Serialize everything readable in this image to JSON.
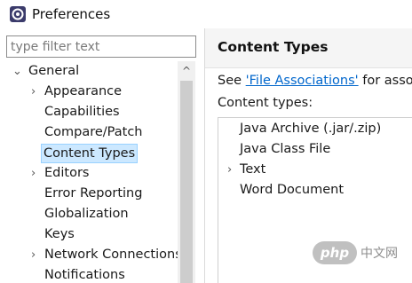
{
  "window": {
    "title": "Preferences"
  },
  "filter": {
    "placeholder": "type filter text"
  },
  "tree": [
    {
      "label": "General",
      "twisty": "⌄"
    },
    {
      "label": "Appearance",
      "twisty": "›"
    },
    {
      "label": "Capabilities",
      "twisty": ""
    },
    {
      "label": "Compare/Patch",
      "twisty": ""
    },
    {
      "label": "Content Types",
      "twisty": "",
      "selected": true
    },
    {
      "label": "Editors",
      "twisty": "›"
    },
    {
      "label": "Error Reporting",
      "twisty": ""
    },
    {
      "label": "Globalization",
      "twisty": ""
    },
    {
      "label": "Keys",
      "twisty": ""
    },
    {
      "label": "Network Connections",
      "twisty": "›"
    },
    {
      "label": "Notifications",
      "twisty": ""
    }
  ],
  "scrollbar": {
    "up_glyph": "^"
  },
  "page": {
    "title": "Content Types",
    "see_prefix": "See ",
    "link_text": "'File Associations'",
    "see_suffix": " for associ",
    "content_types_label": "Content types:"
  },
  "content_types": [
    {
      "label": "Java Archive (.jar/.zip)",
      "twisty": ""
    },
    {
      "label": "Java Class File",
      "twisty": ""
    },
    {
      "label": "Text",
      "twisty": "›"
    },
    {
      "label": "Word Document",
      "twisty": ""
    }
  ],
  "watermark": {
    "logo": "php",
    "text": "中文网"
  },
  "colors": {
    "selection": "#cce8ff",
    "link": "#0066cc",
    "header_bg": "#f5f5f5"
  }
}
